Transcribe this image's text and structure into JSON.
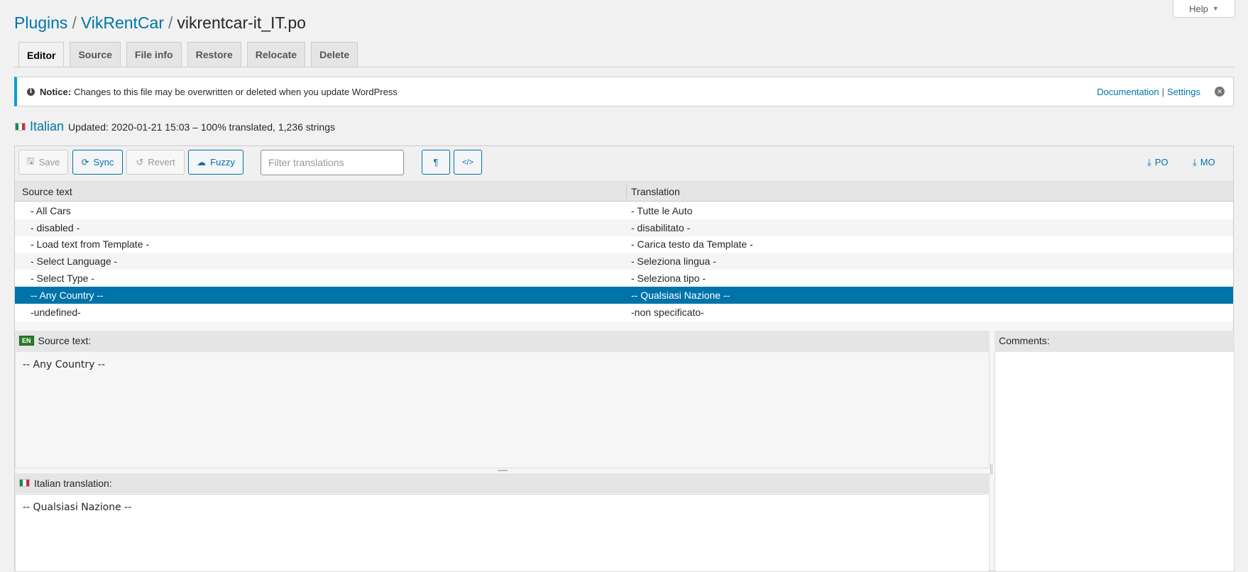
{
  "header": {
    "help_label": "Help",
    "breadcrumb": [
      "Plugins",
      "VikRentCar",
      "vikrentcar-it_IT.po"
    ],
    "separator": "/"
  },
  "tabs": [
    {
      "label": "Editor",
      "active": true
    },
    {
      "label": "Source",
      "active": false
    },
    {
      "label": "File info",
      "active": false
    },
    {
      "label": "Restore",
      "active": false
    },
    {
      "label": "Relocate",
      "active": false
    },
    {
      "label": "Delete",
      "active": false
    }
  ],
  "notice": {
    "title": "Notice:",
    "text": "Changes to this file may be overwritten or deleted when you update WordPress",
    "documentation": "Documentation",
    "pipe": "|",
    "settings": "Settings",
    "close_icon": "close-icon",
    "accent_color": "#00a0d2"
  },
  "language": {
    "name": "Italian",
    "status": "Updated: 2020-01-21 15:03 – 100% translated, 1,236 strings"
  },
  "toolbar": {
    "save": "Save",
    "sync": "Sync",
    "revert": "Revert",
    "fuzzy": "Fuzzy",
    "filter_placeholder": "Filter translations",
    "pilcrow": "¶",
    "code": "</>",
    "po": "PO",
    "mo": "MO"
  },
  "grid": {
    "col_source": "Source text",
    "col_translation": "Translation",
    "rows": [
      {
        "source": "- All Cars",
        "translation": "- Tutte le Auto"
      },
      {
        "source": "- disabled -",
        "translation": "- disabilitato -"
      },
      {
        "source": "- Load text from Template -",
        "translation": "- Carica testo da Template -"
      },
      {
        "source": "- Select Language -",
        "translation": "- Seleziona lingua -"
      },
      {
        "source": "- Select Type -",
        "translation": "- Seleziona tipo -"
      },
      {
        "source": "-- Any Country --",
        "translation": "-- Qualsiasi Nazione --"
      },
      {
        "source": "-undefined-",
        "translation": "-non specificato-"
      }
    ],
    "selected_index": 5,
    "selected_color": "#0073aa"
  },
  "source_panel": {
    "badge": "EN",
    "label": "Source text:",
    "text": "-- Any Country --"
  },
  "translation_panel": {
    "label": "Italian translation:",
    "text": "-- Qualsiasi Nazione --"
  },
  "comments_panel": {
    "label": "Comments:"
  }
}
